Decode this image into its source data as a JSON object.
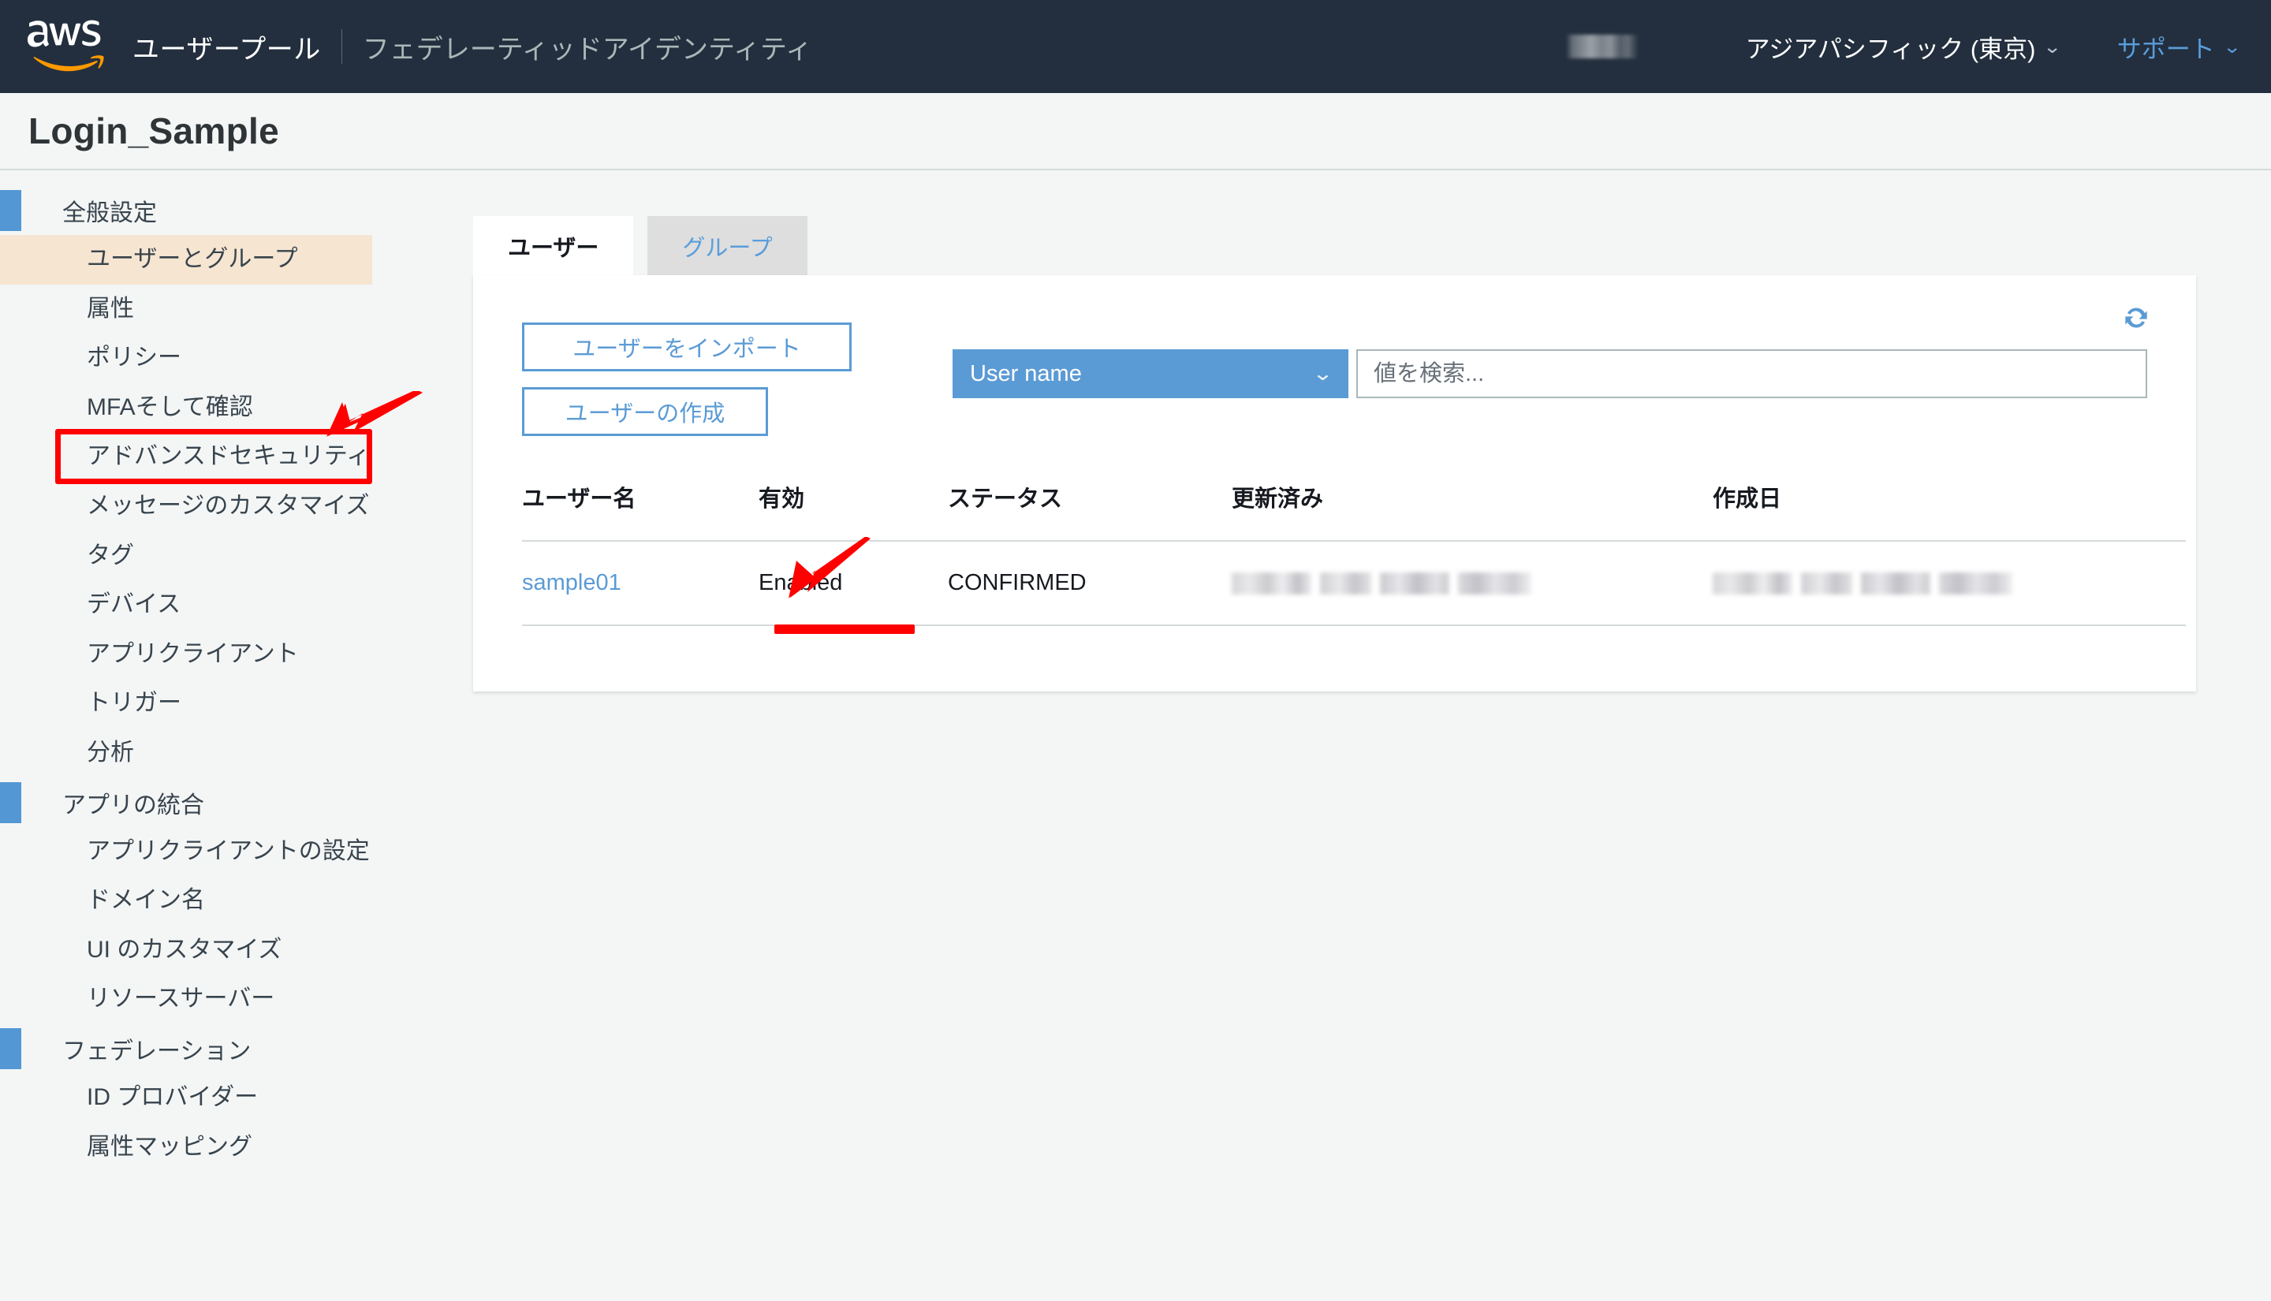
{
  "topnav": {
    "logo_alt": "aws-logo",
    "primary_label": "ユーザープール",
    "secondary_label": "フェデレーティッドアイデンティティ",
    "account_blurred": "",
    "region_label": "アジアパシフィック (東京)",
    "support_label": "サポート",
    "caret": "⌄"
  },
  "page": {
    "title": "Login_Sample"
  },
  "sidebar": {
    "groups": [
      {
        "label": "全般設定",
        "items": [
          {
            "label": "ユーザーとグループ",
            "selected": true
          },
          {
            "label": "属性",
            "selected": false
          },
          {
            "label": "ポリシー",
            "selected": false
          },
          {
            "label": "MFAそして確認",
            "selected": false
          },
          {
            "label": "アドバンスドセキュリティ",
            "selected": false
          },
          {
            "label": "メッセージのカスタマイズ",
            "selected": false
          },
          {
            "label": "タグ",
            "selected": false
          },
          {
            "label": "デバイス",
            "selected": false
          },
          {
            "label": "アプリクライアント",
            "selected": false
          },
          {
            "label": "トリガー",
            "selected": false
          },
          {
            "label": "分析",
            "selected": false
          }
        ]
      },
      {
        "label": "アプリの統合",
        "items": [
          {
            "label": "アプリクライアントの設定",
            "selected": false
          },
          {
            "label": "ドメイン名",
            "selected": false
          },
          {
            "label": "UI のカスタマイズ",
            "selected": false
          },
          {
            "label": "リソースサーバー",
            "selected": false
          }
        ]
      },
      {
        "label": "フェデレーション",
        "items": [
          {
            "label": "ID プロバイダー",
            "selected": false
          },
          {
            "label": "属性マッピング",
            "selected": false
          }
        ]
      }
    ]
  },
  "main": {
    "tabs": [
      {
        "label": "ユーザー",
        "active": true
      },
      {
        "label": "グループ",
        "active": false
      }
    ],
    "refresh_icon": "refresh-icon",
    "buttons": {
      "import_label": "ユーザーをインポート",
      "create_label": "ユーザーの作成"
    },
    "filter": {
      "attribute_value": "User name",
      "caret": "⌄",
      "search_value": "",
      "search_placeholder": "値を検索..."
    },
    "table": {
      "headers": [
        "ユーザー名",
        "有効",
        "ステータス",
        "更新済み",
        "作成日"
      ],
      "rows": [
        {
          "username": "sample01",
          "enabled": "Enabled",
          "status": "CONFIRMED",
          "updated": "",
          "created": ""
        }
      ]
    }
  },
  "annotations": {
    "sidebar_highlight_color": "#ff0000",
    "sidebar_selected_bg": "#f6e5d1",
    "status_underline_color": "#ff0000",
    "arrow_color": "#ff0000"
  },
  "colors": {
    "nav_bg": "#232f3e",
    "page_bg": "#f4f6f6",
    "accent_blue": "#5b9bd5",
    "group_marker": "#5398d4",
    "link_blue": "#5a9ddb"
  }
}
